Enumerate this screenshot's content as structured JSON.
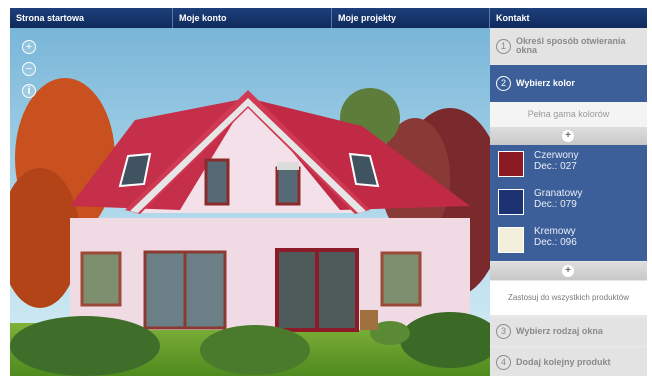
{
  "nav": {
    "items": [
      "Strona startowa",
      "Moje konto",
      "Moje projekty",
      "Kontakt"
    ]
  },
  "zoom": {
    "plus": "+",
    "minus": "−",
    "info": "i"
  },
  "steps": [
    {
      "number": "1",
      "label": "Określ sposób otwierania okna",
      "state": "inactive"
    },
    {
      "number": "2",
      "label": "Wybierz kolor",
      "state": "active"
    },
    {
      "number": "3",
      "label": "Wybierz rodzaj okna",
      "state": "inactive"
    },
    {
      "number": "4",
      "label": "Dodaj kolejny produkt",
      "state": "inactive"
    }
  ],
  "full_range_label": "Pełna gama kolorów",
  "scroll_glyph": "+",
  "colors": [
    {
      "name": "Czerwony",
      "code": "Dec.: 027",
      "swatch": "#8b1a22"
    },
    {
      "name": "Granatowy",
      "code": "Dec.: 079",
      "swatch": "#1c3271"
    },
    {
      "name": "Kremowy",
      "code": "Dec.: 096",
      "swatch": "#f3efdc"
    }
  ],
  "apply_all_label": "Zastosuj do wszystkich produktów",
  "palette": {
    "nav_bg": "#16336b",
    "panel_active": "#3d5f99",
    "roof": "#c8304a",
    "wall": "#f2dde6",
    "sky": "#8cc4e0"
  }
}
